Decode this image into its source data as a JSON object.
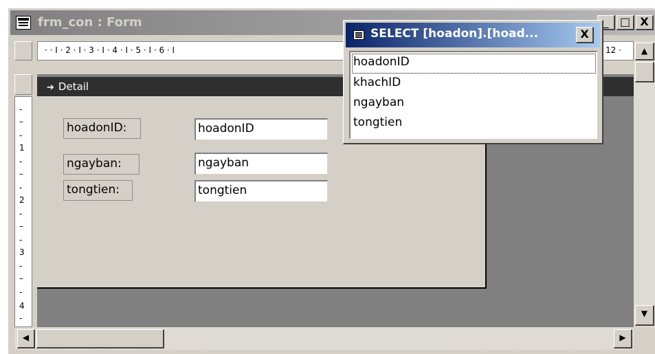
{
  "window": {
    "title": "frm_con : Form",
    "minimize": "_",
    "restore": "□",
    "close": "X"
  },
  "ruler": {
    "h_marks": [
      "· · I · 2 · I · 3 · I · 4 · I · 5 · I · 6 · I",
      "12 ·"
    ],
    "v_marks": [
      "-",
      "–",
      "-",
      "1",
      "-",
      "–",
      "-",
      "2",
      "-",
      "–",
      "-",
      "3",
      "-",
      "–",
      "-",
      "4",
      "-"
    ]
  },
  "detail": {
    "arrow": "➔",
    "label": "Detail"
  },
  "form_controls": [
    {
      "label": "hoadonID:",
      "field": "hoadonID"
    },
    {
      "label": "ngayban:",
      "field": "ngayban"
    },
    {
      "label": "tongtien:",
      "field": "tongtien"
    }
  ],
  "field_list": {
    "title": "SELECT [hoadon].[hoad...",
    "close": "X",
    "fields": [
      "hoadonID",
      "khachID",
      "ngayban",
      "tongtien"
    ],
    "selected": "hoadonID"
  },
  "scroll": {
    "up": "▲",
    "down": "▼",
    "left": "◀",
    "right": "▶"
  }
}
